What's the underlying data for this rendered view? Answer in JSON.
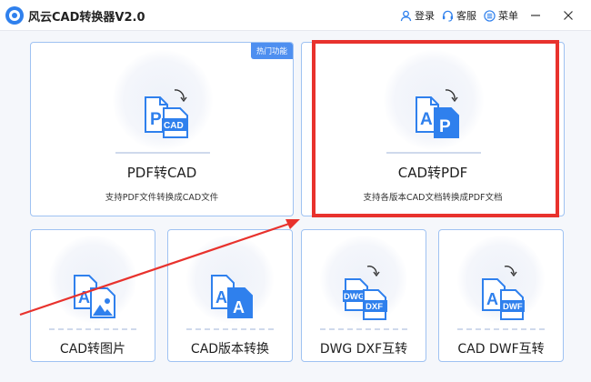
{
  "window": {
    "title": "风云CAD转换器V2.0",
    "actions": [
      {
        "label": "登录",
        "icon": "user-icon"
      },
      {
        "label": "客服",
        "icon": "headset-icon"
      },
      {
        "label": "菜单",
        "icon": "menu-icon"
      }
    ]
  },
  "cards": {
    "pdf_to_cad": {
      "title": "PDF转CAD",
      "desc": "支持PDF文件转换成CAD文件",
      "badge": "热门功能",
      "icon_labels": [
        "P",
        "CAD"
      ]
    },
    "cad_to_pdf": {
      "title": "CAD转PDF",
      "desc": "支持各版本CAD文档转换成PDF文档",
      "icon_labels": [
        "A",
        "P"
      ]
    },
    "cad_to_image": {
      "title": "CAD转图片",
      "icon_labels": [
        "A"
      ]
    },
    "cad_version": {
      "title": "CAD版本转换",
      "icon_labels": [
        "A",
        "A"
      ]
    },
    "dwg_dxf": {
      "title": "DWG DXF互转",
      "icon_labels": [
        "DWG",
        "DXF"
      ]
    },
    "cad_dwf": {
      "title": "CAD DWF互转",
      "icon_labels": [
        "A",
        "DWF"
      ]
    }
  },
  "colors": {
    "accent": "#2f80ed",
    "card_border": "#9fc2f2",
    "highlight": "#e8322d",
    "background": "#f5f7fb"
  }
}
